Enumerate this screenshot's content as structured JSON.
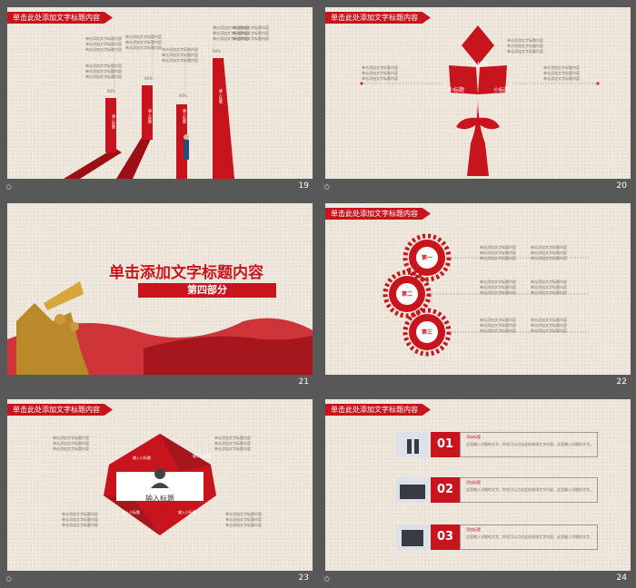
{
  "theme": {
    "accent": "#c8151d",
    "accent_dark": "#9e0f15",
    "bg": "#efe8de",
    "frame": "#585858"
  },
  "slide_title": "单击此处添加文字标题内容",
  "filler_text": "单击添加文字标题内容\n单击添加文字标题内容\n单击添加文字标题内容",
  "slides": [
    {
      "page": "19",
      "percents": [
        "80%",
        "60%",
        "40%",
        "90%"
      ],
      "bars": [
        "输入标题",
        "输入标题",
        "输入标题",
        "输入标题"
      ]
    },
    {
      "page": "20",
      "petals": [
        "小标题",
        "小标题",
        "小标题"
      ]
    },
    {
      "page": "21",
      "headline": "单击添加文字标题内容",
      "section": "第四部分"
    },
    {
      "page": "22",
      "gears": [
        "第一",
        "第二",
        "第三"
      ]
    },
    {
      "page": "23",
      "center_title": "输入标题",
      "side_labels": [
        "输入小标题",
        "输入小标题",
        "输入小标题",
        "输入小标题"
      ]
    },
    {
      "page": "24",
      "items": [
        {
          "num": "01",
          "heading": "添加标题",
          "text": "这里输入详细的文字，你也可以点击此处修改文字内容。这里输入详细的文字。"
        },
        {
          "num": "02",
          "heading": "添加标题",
          "text": "这里输入详细的文字，你也可以点击此处修改文字内容。这里输入详细的文字。"
        },
        {
          "num": "03",
          "heading": "添加标题",
          "text": "这里输入详细的文字，你也可以点击此处修改文字内容。这里输入详细的文字。"
        }
      ]
    }
  ]
}
